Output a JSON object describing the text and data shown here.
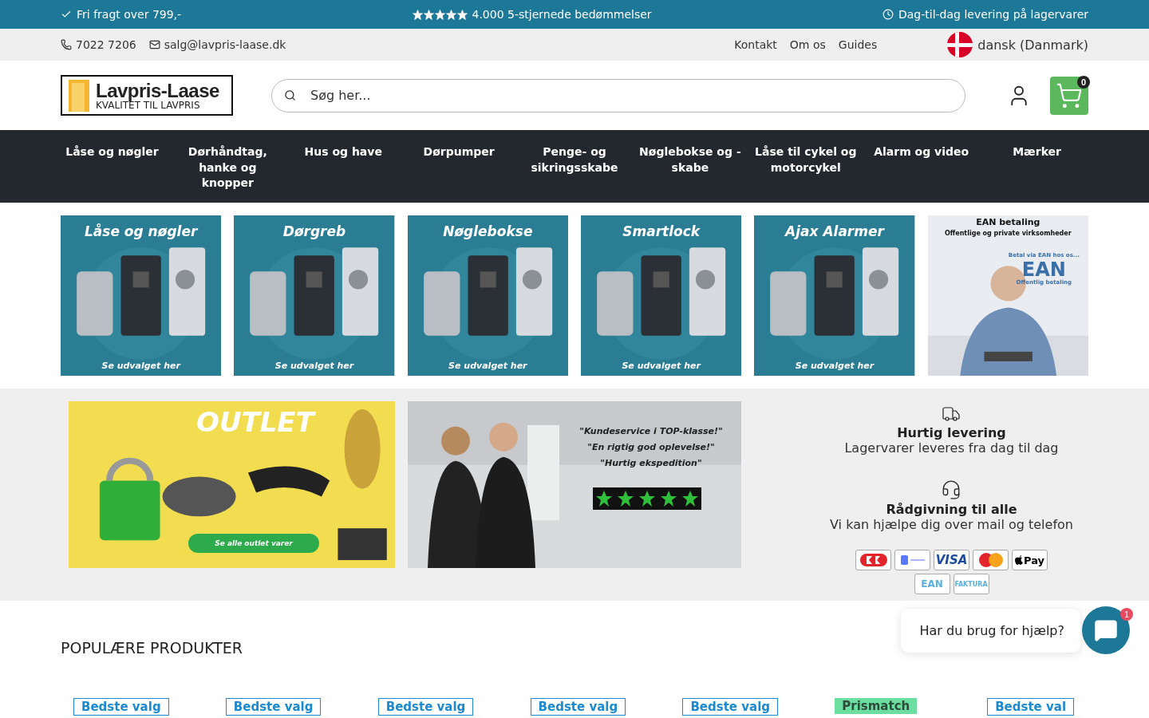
{
  "announcements": [
    {
      "kind": "icon",
      "text": "Fri fragt over 799,-"
    },
    {
      "kind": "stars",
      "stars": 5,
      "text": "4.000 5-stjernede bedømmelser"
    },
    {
      "kind": "icon",
      "text": "Dag-til-dag levering på lagervarer"
    }
  ],
  "contact": {
    "phone": "7022 7206",
    "email": "salg@lavpris-laase.dk"
  },
  "top_links": [
    "Kontakt",
    "Om os",
    "Guides"
  ],
  "language": "dansk (Danmark)",
  "logo": {
    "name": "Lavpris-Laase",
    "tagline": "KVALITET TIL LAVPRIS"
  },
  "search": {
    "placeholder": "Søg her..."
  },
  "cart": {
    "count": "0"
  },
  "nav": [
    "Låse og nøgler",
    "Dørhåndtag, hanke og knopper",
    "Hus og have",
    "Dørpumper",
    "Penge- og sikringsskabe",
    "Nøglebokse og -skabe",
    "Låse til cykel og motorcykel",
    "Alarm og video",
    "Mærker"
  ],
  "category_tiles": [
    {
      "kind": "teal",
      "title": "Låse og nøgler",
      "cta": "Se udvalget her"
    },
    {
      "kind": "teal",
      "title": "Dørgreb",
      "cta": "Se udvalget her"
    },
    {
      "kind": "teal",
      "title": "Nøglebokse",
      "cta": "Se udvalget her"
    },
    {
      "kind": "teal",
      "title": "Smartlock",
      "cta": "Se udvalget her"
    },
    {
      "kind": "teal",
      "title": "Ajax Alarmer",
      "cta": "Se udvalget her"
    },
    {
      "kind": "ean",
      "title": "EAN betaling",
      "subtitle": "Offentlige og private virksomheder",
      "badge_top": "Betal via EAN hos os...",
      "badge_main": "EAN",
      "badge_sub": "Offentlig betaling"
    }
  ],
  "banners": [
    {
      "kind": "outlet",
      "title": "OUTLET",
      "cta": "Se alle outlet varer"
    },
    {
      "kind": "service",
      "quotes": [
        "\"Kundeservice i TOP-klasse!\"",
        "\"En rigtig god oplevelse!\"",
        "\"Hurtig ekspedition\""
      ],
      "stars": 5
    }
  ],
  "features": [
    {
      "kind": "truck",
      "title": "Hurtig levering",
      "text": "Lagervarer leveres fra dag til dag"
    },
    {
      "kind": "headset",
      "title": "Rådgivning til alle",
      "text": "Vi kan hjælpe dig over mail og telefon"
    }
  ],
  "payments": [
    {
      "kind": "dankort"
    },
    {
      "kind": "mobilepay"
    },
    {
      "kind": "visa",
      "label": "VISA"
    },
    {
      "kind": "mastercard"
    },
    {
      "kind": "applepay",
      "label": "Pay"
    },
    {
      "kind": "ean",
      "label": "EAN"
    },
    {
      "kind": "faktura",
      "label": "FAKTURA"
    }
  ],
  "popular": {
    "heading": "POPULÆRE PRODUKTER",
    "products": [
      {
        "badge": "Bedste valg",
        "kind": "best"
      },
      {
        "badge": "Bedste valg",
        "kind": "best"
      },
      {
        "badge": "Bedste valg",
        "kind": "best"
      },
      {
        "badge": "Bedste valg",
        "kind": "best"
      },
      {
        "badge": "Bedste valg",
        "kind": "best"
      },
      {
        "badge": "Prismatch",
        "kind": "match"
      },
      {
        "badge": "Bedste val",
        "kind": "best"
      }
    ]
  },
  "chat": {
    "text": "Har du brug for hjælp?",
    "count": "1"
  }
}
